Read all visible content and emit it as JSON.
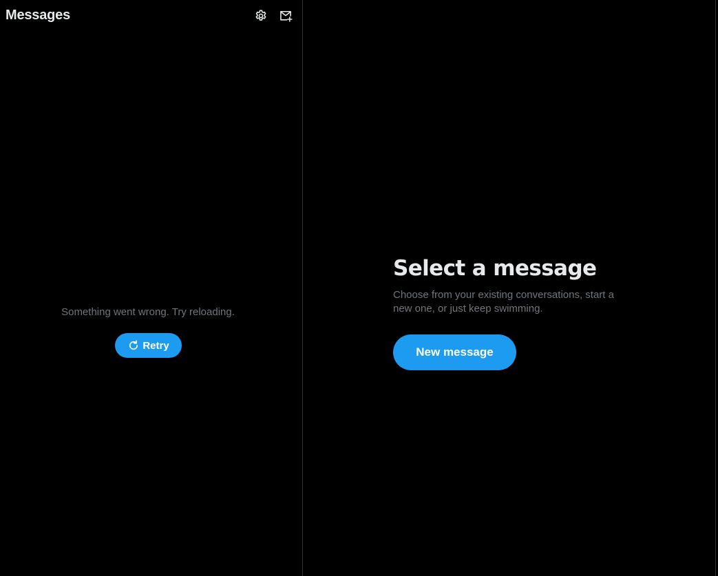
{
  "colors": {
    "background": "#000000",
    "accent": "#1d9bf0",
    "text_primary": "#e7e9ea",
    "text_secondary": "#71767b",
    "divider": "#2f3336"
  },
  "left_panel": {
    "title": "Messages",
    "icons": {
      "settings": "gear-icon",
      "compose": "new-message-icon"
    },
    "error": {
      "message": "Something went wrong. Try reloading.",
      "retry_label": "Retry",
      "retry_icon": "refresh-icon"
    }
  },
  "right_panel": {
    "title": "Select a message",
    "description": "Choose from your existing conversations, start a new one, or just keep swimming.",
    "new_message_label": "New message"
  }
}
